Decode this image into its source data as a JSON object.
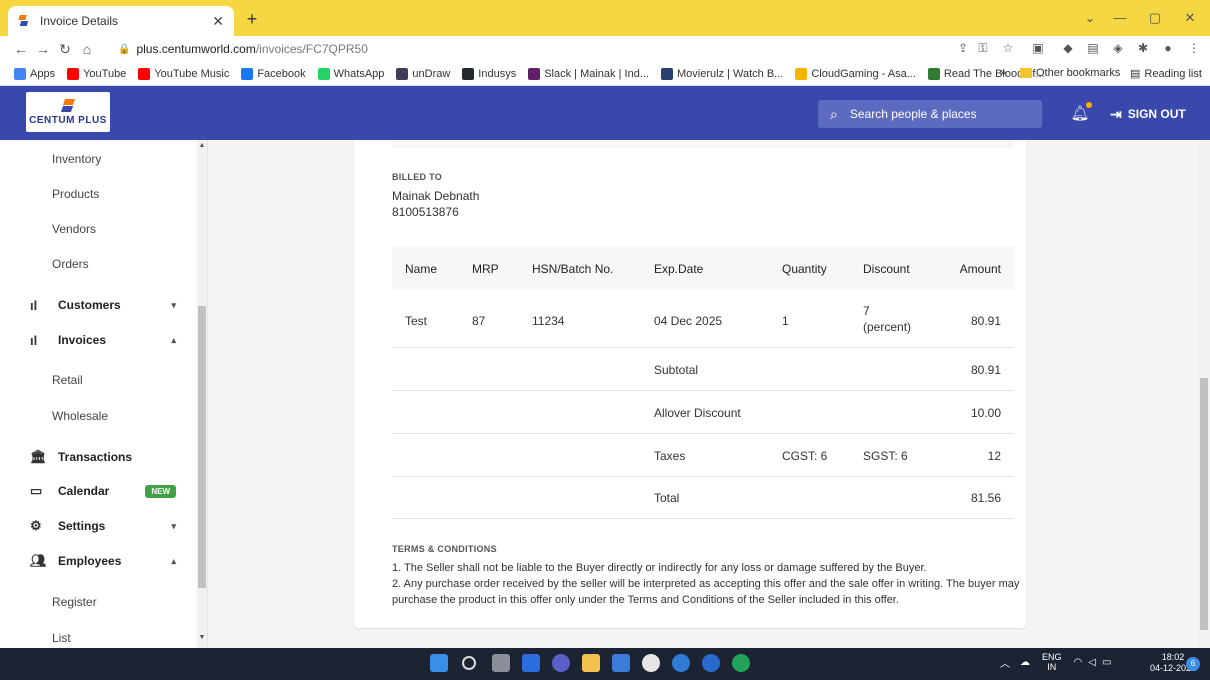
{
  "browser": {
    "tab_title": "Invoice Details",
    "url_host": "plus.centumworld.com",
    "url_path": "/invoices/FC7QPR50",
    "bookmarks": [
      {
        "label": "Apps",
        "color": "#4285f4"
      },
      {
        "label": "YouTube",
        "color": "#ff0000"
      },
      {
        "label": "YouTube Music",
        "color": "#ff0000"
      },
      {
        "label": "Facebook",
        "color": "#1877f2"
      },
      {
        "label": "WhatsApp",
        "color": "#25d366"
      },
      {
        "label": "unDraw",
        "color": "#3f3d56"
      },
      {
        "label": "Indusys",
        "color": "#24292e"
      },
      {
        "label": "Slack | Mainak | Ind...",
        "color": "#611f69"
      },
      {
        "label": "Movierulz | Watch B...",
        "color": "#2a3f6f"
      },
      {
        "label": "CloudGaming - Asa...",
        "color": "#f4b400"
      },
      {
        "label": "Read The Blood of...",
        "color": "#2e7d32"
      }
    ],
    "bookmarks_more": "»",
    "other_bookmarks": "Other bookmarks",
    "reading_list": "Reading list"
  },
  "header": {
    "logo_text": "CENTUM PLUS",
    "search_placeholder": "Search people & places",
    "signout_label": "SIGN OUT",
    "brand_color": "#3949ab"
  },
  "sidebar": {
    "items": [
      {
        "label": "Inventory"
      },
      {
        "label": "Products"
      },
      {
        "label": "Vendors"
      },
      {
        "label": "Orders"
      },
      {
        "label": "Customers"
      },
      {
        "label": "Invoices"
      },
      {
        "label": "Retail"
      },
      {
        "label": "Wholesale"
      },
      {
        "label": "Transactions"
      },
      {
        "label": "Calendar",
        "badge": "NEW"
      },
      {
        "label": "Settings"
      },
      {
        "label": "Employees"
      },
      {
        "label": "Register"
      },
      {
        "label": "List"
      }
    ]
  },
  "invoice": {
    "billed_to_label": "BILLED TO",
    "customer_name": "Mainak Debnath",
    "customer_phone": "8100513876",
    "columns": [
      "Name",
      "MRP",
      "HSN/Batch No.",
      "Exp.Date",
      "Quantity",
      "Discount",
      "Amount"
    ],
    "item": {
      "name": "Test",
      "mrp": "87",
      "hsn": "11234",
      "exp_date": "04 Dec 2025",
      "quantity": "1",
      "discount": "7",
      "discount_unit": "(percent)",
      "amount": "80.91"
    },
    "subtotal_label": "Subtotal",
    "subtotal": "80.91",
    "allover_discount_label": "Allover Discount",
    "allover_discount": "10.00",
    "taxes_label": "Taxes",
    "cgst": "CGST: 6",
    "sgst": "SGST: 6",
    "taxes_total": "12",
    "total_label": "Total",
    "total": "81.56",
    "terms_label": "TERMS & CONDITIONS",
    "terms": [
      "1. The Seller shall not be liable to the Buyer directly or indirectly for any loss or damage suffered by the Buyer.",
      "2. Any purchase order received by the seller will be interpreted as accepting this offer and the sale offer in writing. The buyer may purchase the product in this offer only under the Terms and Conditions of the Seller included in this offer."
    ]
  },
  "taskbar": {
    "lang_top": "ENG",
    "lang_bottom": "IN",
    "time": "18:02",
    "date": "04-12-2021",
    "notification_count": "6"
  }
}
